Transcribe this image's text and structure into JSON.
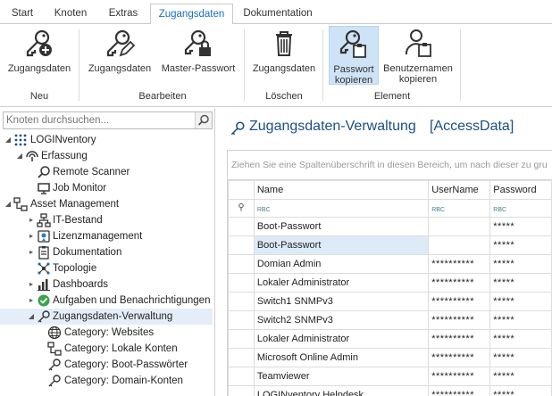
{
  "ribbon_tabs": [
    "Start",
    "Knoten",
    "Extras",
    "Zugangsdaten",
    "Dokumentation"
  ],
  "ribbon_active_tab": "Zugangsdaten",
  "ribbon": {
    "new_btn": "Zugangsdaten",
    "edit_btn": "Zugangsdaten",
    "master_btn": "Master-Passwort",
    "delete_btn": "Zugangsdaten",
    "copy_pw_line1": "Passwort",
    "copy_pw_line2": "kopieren",
    "copy_user_line1": "Benutzernamen",
    "copy_user_line2": "kopieren",
    "group_new": "Neu",
    "group_edit": "Bearbeiten",
    "group_delete": "Löschen",
    "group_element": "Element"
  },
  "search": {
    "placeholder": "Knoten durchsuchen..."
  },
  "tree": [
    {
      "label": "LOGINventory"
    },
    {
      "label": "Erfassung"
    },
    {
      "label": "Remote Scanner"
    },
    {
      "label": "Job Monitor"
    },
    {
      "label": "Asset Management"
    },
    {
      "label": "IT-Bestand"
    },
    {
      "label": "Lizenzmanagement"
    },
    {
      "label": "Dokumentation"
    },
    {
      "label": "Topologie"
    },
    {
      "label": "Dashboards"
    },
    {
      "label": "Aufgaben und Benachrichtigungen"
    },
    {
      "label": "Zugangsdaten-Verwaltung"
    },
    {
      "label": "Category: Websites"
    },
    {
      "label": "Category: Lokale Konten"
    },
    {
      "label": "Category: Boot-Passwörter"
    },
    {
      "label": "Category: Domain-Konten"
    }
  ],
  "main": {
    "title": "Zugangsdaten-Verwaltung",
    "title_suffix": "[AccessData]",
    "group_hint": "Ziehen Sie eine Spaltenüberschrift in diesen Bereich, um nach dieser zu gru",
    "columns": [
      "Name",
      "UserName",
      "Password"
    ],
    "rows": [
      {
        "name": "Boot-Passwort",
        "user": "",
        "pw": "*****"
      },
      {
        "name": "Boot-Passwort",
        "user": "",
        "pw": "*****"
      },
      {
        "name": "Domian Admin",
        "user": "**********",
        "pw": "*****"
      },
      {
        "name": "Lokaler Administrator",
        "user": "**********",
        "pw": "*****"
      },
      {
        "name": "Switch1 SNMPv3",
        "user": "**********",
        "pw": "*****"
      },
      {
        "name": "Switch2 SNMPv3",
        "user": "**********",
        "pw": "*****"
      },
      {
        "name": "Lokaler Administrator",
        "user": "**********",
        "pw": "*****"
      },
      {
        "name": "Microsoft Online Admin",
        "user": "**********",
        "pw": "*****"
      },
      {
        "name": "Teamviewer",
        "user": "**********",
        "pw": "*****"
      },
      {
        "name": "LOGINventory Helpdesk",
        "user": "**********",
        "pw": "*****"
      }
    ]
  },
  "colors": {
    "accent": "#1b6ec2",
    "title": "#1a4f86",
    "selection": "#cfe3f7"
  }
}
